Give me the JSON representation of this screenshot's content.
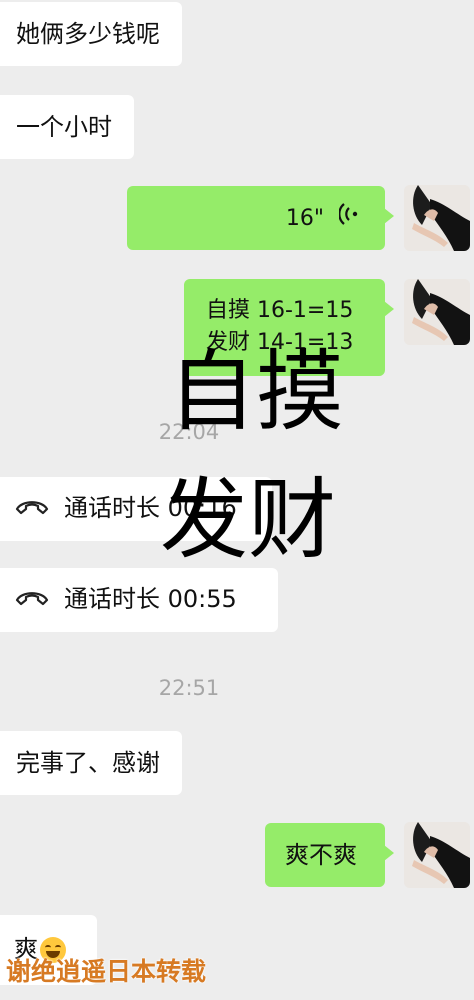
{
  "messages": {
    "m1": "她俩多少钱呢",
    "m2": "一个小时",
    "m3_voice": "16\"",
    "m4_line1": "自摸 16-1=15",
    "m4_line2": "发财 14-1=13",
    "ts1": "22:04",
    "call1": "通话时长 00:16",
    "call2": "通话时长 00:55",
    "ts2": "22:51",
    "m5": "完事了、感谢",
    "m6": "爽不爽",
    "m7": "爽"
  },
  "overlay": {
    "line1": "自摸",
    "line2": "发财"
  },
  "watermark": "谢绝逍遥日本转载",
  "icons": [
    "voice-wave-icon",
    "phone-handset-icon",
    "grinning-emoji-icon",
    "user-avatar"
  ],
  "colors": {
    "background": "#ededed",
    "incoming": "#ffffff",
    "outgoing": "#95ec69",
    "timestamp": "#a6a6a6",
    "watermark": "#d77a23"
  }
}
